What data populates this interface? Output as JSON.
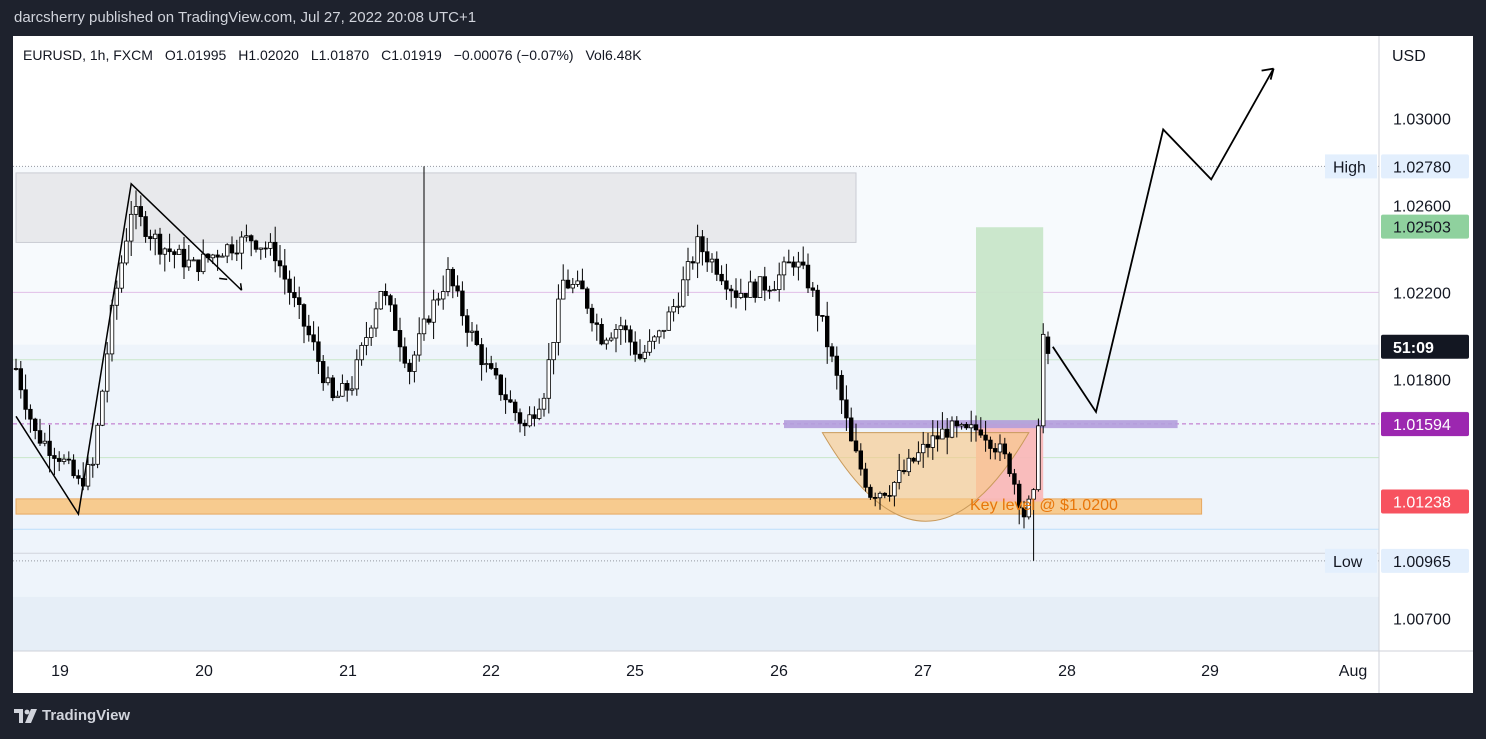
{
  "header": {
    "published_by": "darcsherry published on TradingView.com, Jul 27, 2022 20:08 UTC+1"
  },
  "footer": {
    "brand": "TradingView",
    "logo_icon": "tradingview-logo-icon"
  },
  "legend": {
    "symbol": "EURUSD, 1h, FXCM",
    "open": "O1.01995",
    "high": "H1.02020",
    "low": "L1.01870",
    "close": "C1.01919",
    "change": "−0.00076 (−0.07%)",
    "volume": "Vol6.48K"
  },
  "price_axis": {
    "currency": "USD",
    "ticks": [
      "1.03000",
      "1.02600",
      "1.02200",
      "1.01800",
      "1.00700"
    ],
    "labels": [
      {
        "text": "1.02780",
        "tag": "High",
        "value": 1.0278,
        "bg": "#e3effd",
        "fg": "#131722"
      },
      {
        "text": "1.02503",
        "value": 1.02503,
        "bg": "#8fd19e",
        "fg": "#131722"
      },
      {
        "text": "51:09",
        "value": 1.0195,
        "bg": "#131722",
        "fg": "#ffffff"
      },
      {
        "text": "1.01595",
        "value": 1.01595,
        "bg": "#b2b5be",
        "fg": "#131722"
      },
      {
        "text": "1.01594",
        "value": 1.01594,
        "bg": "#9c27b0",
        "fg": "#ffffff"
      },
      {
        "text": "1.01238",
        "value": 1.01238,
        "bg": "#f7525f",
        "fg": "#ffffff"
      },
      {
        "text": "1.00965",
        "tag": "Low",
        "value": 1.00965,
        "bg": "#e3effd",
        "fg": "#131722"
      }
    ]
  },
  "time_axis": {
    "labels": [
      "19",
      "20",
      "21",
      "22",
      "25",
      "26",
      "27",
      "28",
      "29",
      "Aug"
    ]
  },
  "annotations": {
    "key_level": "Key level @ $1.0200"
  },
  "colors": {
    "up_candle": "#ffffff",
    "down_candle": "#000000",
    "resistance_zone": "#e8e9ec",
    "support_zone": "#f8c98a",
    "target_zone": "#c8e6c9",
    "stop_zone": "#f9b8b8",
    "purple_line": "#b39ddb"
  },
  "chart_data": {
    "type": "candlestick",
    "symbol": "EURUSD",
    "interval": "1h",
    "ylim": [
      1.0055,
      1.0338
    ],
    "x_labels": [
      "19",
      "20",
      "21",
      "22",
      "25",
      "26",
      "27",
      "28",
      "29",
      "Aug"
    ],
    "anchors": [
      [
        0,
        1.0185
      ],
      [
        4,
        1.0155
      ],
      [
        9,
        1.0145
      ],
      [
        13,
        1.0132
      ],
      [
        16,
        1.014
      ],
      [
        20,
        1.021
      ],
      [
        24,
        1.0258
      ],
      [
        30,
        1.0242
      ],
      [
        37,
        1.0232
      ],
      [
        43,
        1.024
      ],
      [
        49,
        1.0245
      ],
      [
        54,
        1.0238
      ],
      [
        58,
        1.0215
      ],
      [
        62,
        1.0195
      ],
      [
        66,
        1.017
      ],
      [
        70,
        1.0178
      ],
      [
        73,
        1.02
      ],
      [
        76,
        1.0222
      ],
      [
        79,
        1.0205
      ],
      [
        82,
        1.0185
      ],
      [
        86,
        1.021
      ],
      [
        90,
        1.0228
      ],
      [
        94,
        1.0205
      ],
      [
        98,
        1.0185
      ],
      [
        102,
        1.0172
      ],
      [
        106,
        1.0158
      ],
      [
        110,
        1.0175
      ],
      [
        114,
        1.0225
      ],
      [
        118,
        1.022
      ],
      [
        122,
        1.02
      ],
      [
        126,
        1.0205
      ],
      [
        130,
        1.019
      ],
      [
        134,
        1.02
      ],
      [
        138,
        1.0218
      ],
      [
        142,
        1.0242
      ],
      [
        146,
        1.0232
      ],
      [
        150,
        1.022
      ],
      [
        154,
        1.0222
      ],
      [
        158,
        1.0225
      ],
      [
        162,
        1.0235
      ],
      [
        165,
        1.0225
      ],
      [
        168,
        1.0205
      ],
      [
        171,
        1.018
      ],
      [
        174,
        1.015
      ],
      [
        178,
        1.0128
      ],
      [
        182,
        1.013
      ],
      [
        186,
        1.014
      ],
      [
        190,
        1.015
      ],
      [
        194,
        1.0157
      ],
      [
        198,
        1.0155
      ],
      [
        201,
        1.0158
      ],
      [
        204,
        1.015
      ],
      [
        207,
        1.014
      ],
      [
        210,
        1.0118
      ],
      [
        212,
        1.0125
      ],
      [
        214,
        1.02
      ],
      [
        215,
        1.0192
      ]
    ],
    "series_high": 1.0278,
    "series_low": 1.00965,
    "last": {
      "open": 1.01995,
      "high": 1.0202,
      "low": 1.0187,
      "close": 1.01919
    },
    "zones": [
      {
        "name": "resistance-zone",
        "y": [
          1.0243,
          1.0275
        ]
      },
      {
        "name": "support-zone",
        "y": [
          1.0118,
          1.0125
        ]
      },
      {
        "name": "target-zone",
        "y": [
          1.01595,
          1.025
        ]
      },
      {
        "name": "stop-zone",
        "y": [
          1.01238,
          1.01595
        ]
      }
    ],
    "horizontal_levels": [
      1.022,
      1.0189,
      1.01595,
      1.0144,
      1.0111,
      1.01
    ],
    "projection": [
      [
        0,
        1.01595
      ],
      [
        216,
        1.0195
      ],
      [
        225,
        1.0165
      ],
      [
        239,
        1.0295
      ],
      [
        249,
        1.0272
      ],
      [
        262,
        1.0323
      ]
    ]
  }
}
